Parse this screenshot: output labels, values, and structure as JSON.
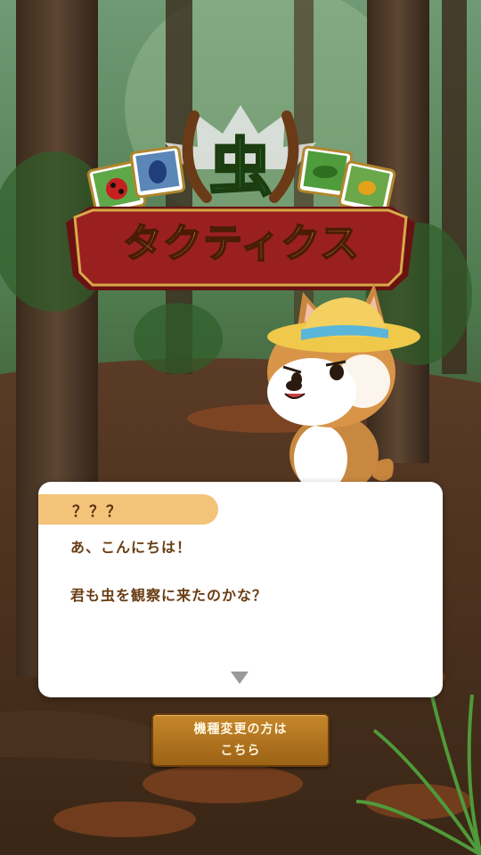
{
  "game": {
    "logo": {
      "kanji": "虫",
      "katakana": "タクティクス"
    }
  },
  "dialog": {
    "speaker": "？？？",
    "lines": [
      "あ、こんにちは！",
      "君も虫を観察に来たのかな？"
    ],
    "next_icon": "triangle-down-icon"
  },
  "device_change_button": {
    "line1": "機種変更の方は",
    "line2": "こちら"
  },
  "colors": {
    "dialog_text": "#6a3d14",
    "speaker_tab": "#f3c37a",
    "button": "#b07420",
    "logo_banner": "#8c1a1a",
    "logo_kanji": "#2f9a2c"
  }
}
